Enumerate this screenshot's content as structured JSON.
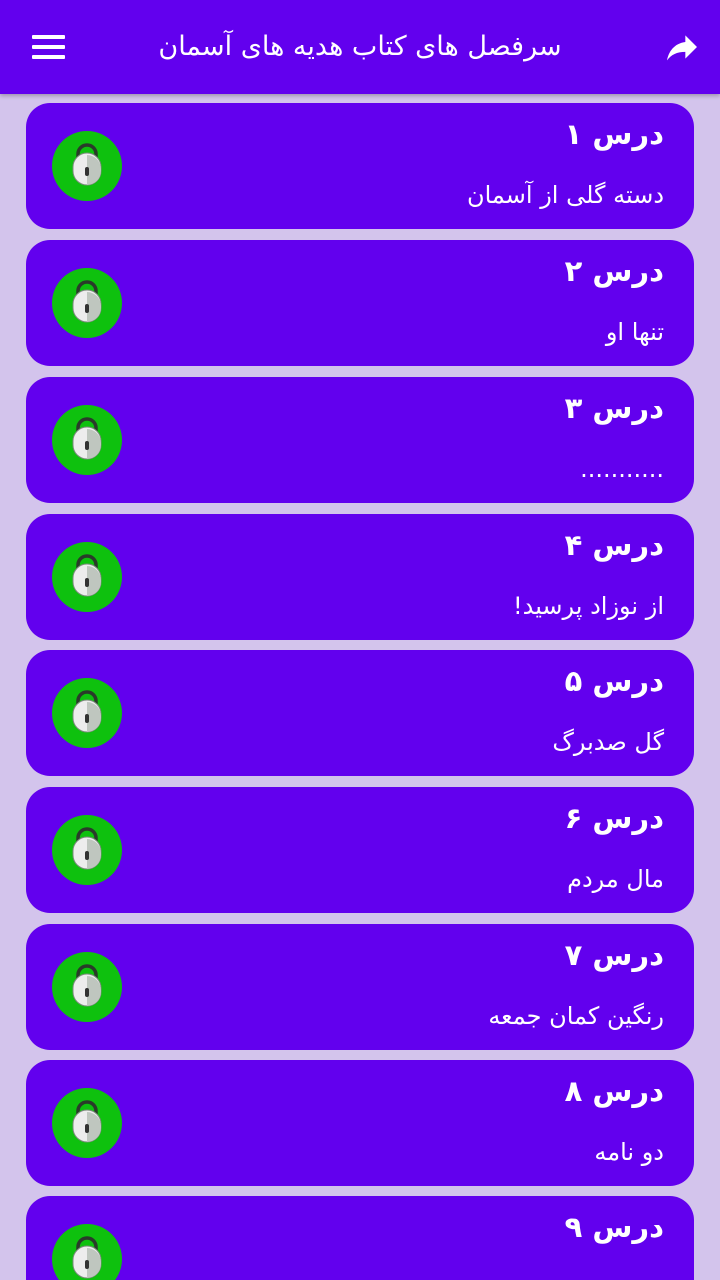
{
  "appbar": {
    "title": "سرفصل های کتاب هدیه های آسمان",
    "menu_icon": "hamburger-menu-icon",
    "share_icon": "share-forward-icon"
  },
  "colors": {
    "primary": "#6200ee",
    "background": "#d3c4ec",
    "lock_green": "#0ec10e",
    "text": "#ffffff"
  },
  "lessons": [
    {
      "title": "درس ۱",
      "subtitle": "دسته گلی  از آسمان"
    },
    {
      "title": "درس ۲",
      "subtitle": "تنها او"
    },
    {
      "title": "درس ۳",
      "subtitle": "..........."
    },
    {
      "title": "درس ۴",
      "subtitle": "از نوزاد پرسید!"
    },
    {
      "title": "درس ۵",
      "subtitle": "گل صدبرگ"
    },
    {
      "title": "درس ۶",
      "subtitle": "مال مردم"
    },
    {
      "title": "درس ۷",
      "subtitle": "رنگین کمان جمعه"
    },
    {
      "title": "درس ۸",
      "subtitle": "دو نامه"
    },
    {
      "title": "درس ۹",
      "subtitle": ""
    }
  ]
}
